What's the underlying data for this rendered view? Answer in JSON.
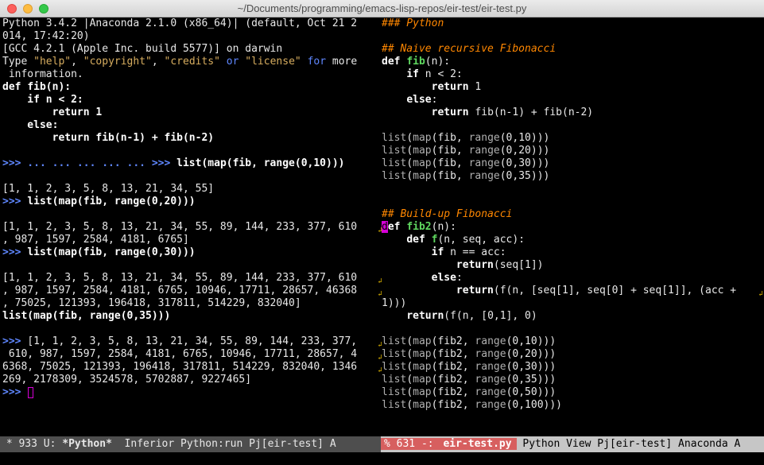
{
  "window": {
    "title": "~/Documents/programming/emacs-lisp-repos/eir-test/eir-test.py"
  },
  "left_pane": {
    "lines": [
      [
        {
          "t": "Python 3.4.2 |Anaconda 2.1.0 (x86_64)| (default, Oct 21 2"
        }
      ],
      [
        {
          "t": "014, 17:42:20)"
        }
      ],
      [
        {
          "t": "[GCC 4.2.1 (Apple Inc. build 5577)] on darwin"
        }
      ],
      [
        {
          "t": "Type "
        },
        {
          "t": "\"help\"",
          "c": "str"
        },
        {
          "t": ", "
        },
        {
          "t": "\"copyright\"",
          "c": "str"
        },
        {
          "t": ", "
        },
        {
          "t": "\"credits\"",
          "c": "str"
        },
        {
          "t": " "
        },
        {
          "t": "or",
          "c": "op"
        },
        {
          "t": " "
        },
        {
          "t": "\"license\"",
          "c": "str"
        },
        {
          "t": " "
        },
        {
          "t": "for",
          "c": "op"
        },
        {
          "t": " more"
        }
      ],
      [
        {
          "t": " information."
        }
      ],
      [
        {
          "t": "def ",
          "c": "kw"
        },
        {
          "t": "fib",
          "c": "bold"
        },
        {
          "t": "(n):",
          "c": "bold"
        }
      ],
      [
        {
          "t": "    if n < 2:",
          "c": "bold"
        }
      ],
      [
        {
          "t": "        return 1",
          "c": "bold"
        }
      ],
      [
        {
          "t": "    else:",
          "c": "bold"
        }
      ],
      [
        {
          "t": "        return fib(n-1) + fib(n-2)",
          "c": "bold"
        }
      ],
      [
        {
          "t": ""
        }
      ],
      [
        {
          "t": ">>> ... ... ... ... ... >>> ",
          "c": "prompt"
        },
        {
          "t": "list(map(fib, range(0,10)))",
          "c": "bold"
        }
      ],
      [
        {
          "t": ""
        }
      ],
      [
        {
          "t": "[1, 1, 2, 3, 5, 8, 13, 21, 34, 55]"
        }
      ],
      [
        {
          "t": ">>> ",
          "c": "prompt"
        },
        {
          "t": "list(map(fib, range(0,20)))",
          "c": "bold"
        }
      ],
      [
        {
          "t": ""
        }
      ],
      [
        {
          "t": "[1, 1, 2, 3, 5, 8, 13, 21, 34, 55, 89, 144, 233, 377, 610"
        }
      ],
      [
        {
          "t": ", 987, 1597, 2584, 4181, 6765]"
        }
      ],
      [
        {
          "t": ">>> ",
          "c": "prompt"
        },
        {
          "t": "list(map(fib, range(0,30)))",
          "c": "bold"
        }
      ],
      [
        {
          "t": ""
        }
      ],
      [
        {
          "t": "[1, 1, 2, 3, 5, 8, 13, 21, 34, 55, 89, 144, 233, 377, 610"
        }
      ],
      [
        {
          "t": ", 987, 1597, 2584, 4181, 6765, 10946, 17711, 28657, 46368"
        }
      ],
      [
        {
          "t": ", 75025, 121393, 196418, 317811, 514229, 832040]"
        }
      ],
      [
        {
          "t": "list(map(fib, range(0,35)))",
          "c": "bold"
        }
      ],
      [
        {
          "t": ""
        }
      ],
      [
        {
          "t": ">>> ",
          "c": "prompt"
        },
        {
          "t": "[1, 1, 2, 3, 5, 8, 13, 21, 34, 55, 89, 144, 233, 377,"
        }
      ],
      [
        {
          "t": " 610, 987, 1597, 2584, 4181, 6765, 10946, 17711, 28657, 4"
        }
      ],
      [
        {
          "t": "6368, 75025, 121393, 196418, 317811, 514229, 832040, 1346"
        }
      ],
      [
        {
          "t": "269, 2178309, 3524578, 5702887, 9227465]"
        }
      ],
      [
        {
          "t": ">>> ",
          "c": "prompt"
        }
      ]
    ]
  },
  "right_pane": {
    "lines": [
      [
        {
          "t": "### Python",
          "c": "cmt"
        }
      ],
      [
        {
          "t": ""
        }
      ],
      [
        {
          "t": "## Naive recursive Fibonacci",
          "c": "cmt"
        }
      ],
      [
        {
          "t": "def ",
          "c": "kw"
        },
        {
          "t": "fib",
          "c": "fn"
        },
        {
          "t": "(n):"
        }
      ],
      [
        {
          "t": "    "
        },
        {
          "t": "if",
          "c": "kw"
        },
        {
          "t": " n < 2:"
        }
      ],
      [
        {
          "t": "        "
        },
        {
          "t": "return",
          "c": "kw"
        },
        {
          "t": " 1"
        }
      ],
      [
        {
          "t": "    "
        },
        {
          "t": "else",
          "c": "kw"
        },
        {
          "t": ":"
        }
      ],
      [
        {
          "t": "        "
        },
        {
          "t": "return",
          "c": "kw"
        },
        {
          "t": " fib(n-1) + fib(n-2)"
        }
      ],
      [
        {
          "t": ""
        }
      ],
      [
        {
          "t": "list",
          "c": "builtin"
        },
        {
          "t": "("
        },
        {
          "t": "map",
          "c": "builtin"
        },
        {
          "t": "(fib, "
        },
        {
          "t": "range",
          "c": "builtin"
        },
        {
          "t": "(0,10)))"
        }
      ],
      [
        {
          "t": "list",
          "c": "builtin"
        },
        {
          "t": "("
        },
        {
          "t": "map",
          "c": "builtin"
        },
        {
          "t": "(fib, "
        },
        {
          "t": "range",
          "c": "builtin"
        },
        {
          "t": "(0,20)))"
        }
      ],
      [
        {
          "t": "list",
          "c": "builtin"
        },
        {
          "t": "("
        },
        {
          "t": "map",
          "c": "builtin"
        },
        {
          "t": "(fib, "
        },
        {
          "t": "range",
          "c": "builtin"
        },
        {
          "t": "(0,30)))"
        }
      ],
      [
        {
          "t": "list",
          "c": "builtin"
        },
        {
          "t": "("
        },
        {
          "t": "map",
          "c": "builtin"
        },
        {
          "t": "(fib, "
        },
        {
          "t": "range",
          "c": "builtin"
        },
        {
          "t": "(0,35)))"
        }
      ],
      [
        {
          "t": ""
        }
      ],
      [
        {
          "t": ""
        }
      ],
      [
        {
          "t": "## Build-up Fibonacci",
          "c": "cmt"
        }
      ],
      [
        {
          "t": "d",
          "c": "hl"
        },
        {
          "t": "ef ",
          "c": "kw"
        },
        {
          "t": "fib2",
          "c": "fn"
        },
        {
          "t": "(n):"
        }
      ],
      [
        {
          "t": "    "
        },
        {
          "t": "def",
          "c": "kw"
        },
        {
          "t": " "
        },
        {
          "t": "f",
          "c": "fn"
        },
        {
          "t": "(n, seq, acc):"
        }
      ],
      [
        {
          "t": "        "
        },
        {
          "t": "if",
          "c": "kw"
        },
        {
          "t": " n == acc:"
        }
      ],
      [
        {
          "t": "            "
        },
        {
          "t": "return",
          "c": "kw"
        },
        {
          "t": "(seq[1])"
        }
      ],
      [
        {
          "t": "        "
        },
        {
          "t": "else",
          "c": "kw"
        },
        {
          "t": ":"
        }
      ],
      [
        {
          "t": "            "
        },
        {
          "t": "return",
          "c": "kw"
        },
        {
          "t": "(f(n, [seq[1], seq[0] + seq[1]], (acc +"
        }
      ],
      [
        {
          "t": "1)))"
        }
      ],
      [
        {
          "t": "    "
        },
        {
          "t": "return",
          "c": "kw"
        },
        {
          "t": "(f(n, [0,1], 0)"
        }
      ],
      [
        {
          "t": ""
        }
      ],
      [
        {
          "t": "list",
          "c": "builtin"
        },
        {
          "t": "("
        },
        {
          "t": "map",
          "c": "builtin"
        },
        {
          "t": "(fib2, "
        },
        {
          "t": "range",
          "c": "builtin"
        },
        {
          "t": "(0,10)))"
        }
      ],
      [
        {
          "t": "list",
          "c": "builtin"
        },
        {
          "t": "("
        },
        {
          "t": "map",
          "c": "builtin"
        },
        {
          "t": "(fib2, "
        },
        {
          "t": "range",
          "c": "builtin"
        },
        {
          "t": "(0,20)))"
        }
      ],
      [
        {
          "t": "list",
          "c": "builtin"
        },
        {
          "t": "("
        },
        {
          "t": "map",
          "c": "builtin"
        },
        {
          "t": "(fib2, "
        },
        {
          "t": "range",
          "c": "builtin"
        },
        {
          "t": "(0,30)))"
        }
      ],
      [
        {
          "t": "list",
          "c": "builtin"
        },
        {
          "t": "("
        },
        {
          "t": "map",
          "c": "builtin"
        },
        {
          "t": "(fib2, "
        },
        {
          "t": "range",
          "c": "builtin"
        },
        {
          "t": "(0,35)))"
        }
      ],
      [
        {
          "t": "list",
          "c": "builtin"
        },
        {
          "t": "("
        },
        {
          "t": "map",
          "c": "builtin"
        },
        {
          "t": "(fib2, "
        },
        {
          "t": "range",
          "c": "builtin"
        },
        {
          "t": "(0,50)))"
        }
      ],
      [
        {
          "t": "list",
          "c": "builtin"
        },
        {
          "t": "("
        },
        {
          "t": "map",
          "c": "builtin"
        },
        {
          "t": "(fib2, "
        },
        {
          "t": "range",
          "c": "builtin"
        },
        {
          "t": "(0,100)))"
        }
      ]
    ]
  },
  "modeline_left": {
    "status": " * 933 U: ",
    "buffer": "*Python*",
    "rest": "  Inferior Python:run Pj[eir-test] A"
  },
  "modeline_right": {
    "status": "% 631 -: ",
    "buffer": "eir-test.py",
    "rest": " Python View Pj[eir-test] Anaconda A"
  },
  "colors": {
    "prompt": "#5f87ff",
    "string": "#d7ad5f",
    "comment": "#ff8700",
    "function": "#5fd75f",
    "cursor": "#d700d7",
    "modeline_active": "#c6c6c6"
  },
  "icons": [
    "close-icon",
    "minimize-icon",
    "maximize-icon",
    "wrap-indicator-icon"
  ]
}
